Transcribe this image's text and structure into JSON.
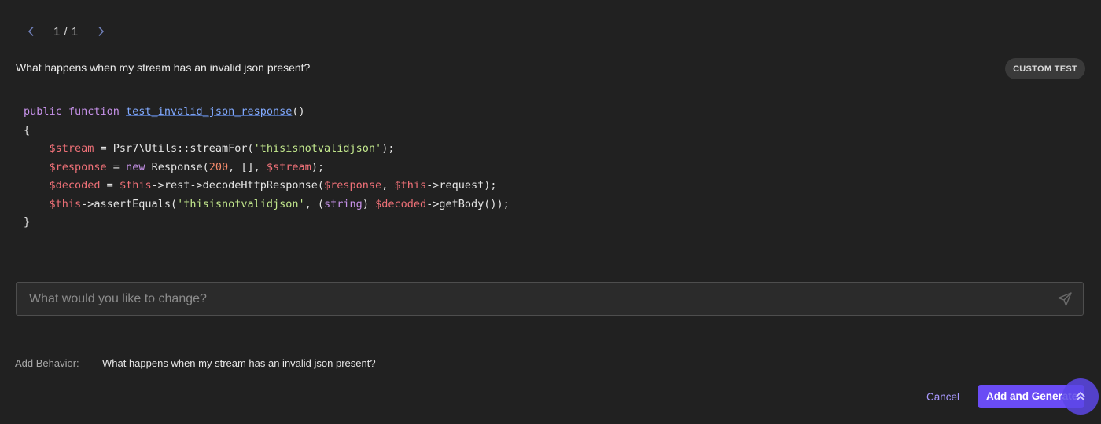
{
  "pager": {
    "count": "1 / 1",
    "prev_icon": "chevron-left-icon",
    "next_icon": "chevron-right-icon"
  },
  "test": {
    "question": "What happens when my stream has an invalid json present?",
    "badge": "CUSTOM TEST",
    "code_lines": [
      [
        {
          "t": "public function ",
          "c": "kw"
        },
        {
          "t": "test_invalid_json_response",
          "c": "fn"
        },
        {
          "t": "()",
          "c": "plain"
        }
      ],
      [
        {
          "t": "{",
          "c": "plain"
        }
      ],
      [
        {
          "t": "    ",
          "c": "plain"
        },
        {
          "t": "$stream",
          "c": "var"
        },
        {
          "t": " = Psr7\\Utils::streamFor(",
          "c": "plain"
        },
        {
          "t": "'thisisnotvalidjson'",
          "c": "str"
        },
        {
          "t": ");",
          "c": "plain"
        }
      ],
      [
        {
          "t": "    ",
          "c": "plain"
        },
        {
          "t": "$response",
          "c": "var"
        },
        {
          "t": " = ",
          "c": "plain"
        },
        {
          "t": "new",
          "c": "kw"
        },
        {
          "t": " Response(",
          "c": "plain"
        },
        {
          "t": "200",
          "c": "num"
        },
        {
          "t": ", [], ",
          "c": "plain"
        },
        {
          "t": "$stream",
          "c": "var"
        },
        {
          "t": ");",
          "c": "plain"
        }
      ],
      [
        {
          "t": "    ",
          "c": "plain"
        },
        {
          "t": "$decoded",
          "c": "var"
        },
        {
          "t": " = ",
          "c": "plain"
        },
        {
          "t": "$this",
          "c": "var"
        },
        {
          "t": "->rest->decodeHttpResponse(",
          "c": "plain"
        },
        {
          "t": "$response",
          "c": "var"
        },
        {
          "t": ", ",
          "c": "plain"
        },
        {
          "t": "$this",
          "c": "var"
        },
        {
          "t": "->request);",
          "c": "plain"
        }
      ],
      [
        {
          "t": "    ",
          "c": "plain"
        },
        {
          "t": "$this",
          "c": "var"
        },
        {
          "t": "->assertEquals(",
          "c": "plain"
        },
        {
          "t": "'thisisnotvalidjson'",
          "c": "str"
        },
        {
          "t": ", (",
          "c": "plain"
        },
        {
          "t": "string",
          "c": "kw"
        },
        {
          "t": ") ",
          "c": "plain"
        },
        {
          "t": "$decoded",
          "c": "var"
        },
        {
          "t": "->getBody());",
          "c": "plain"
        }
      ],
      [
        {
          "t": "}",
          "c": "plain"
        }
      ]
    ]
  },
  "change_input": {
    "placeholder": "What would you like to change?",
    "value": "",
    "send_icon": "send-icon"
  },
  "behavior": {
    "label": "Add Behavior:",
    "value": "What happens when my stream has an invalid json present?"
  },
  "actions": {
    "cancel": "Cancel",
    "primary": "Add and Generate",
    "fab_icon": "double-chevron-up-icon"
  },
  "colors": {
    "background": "#212121",
    "accent": "#6a4cf5",
    "link": "#a999ff"
  }
}
